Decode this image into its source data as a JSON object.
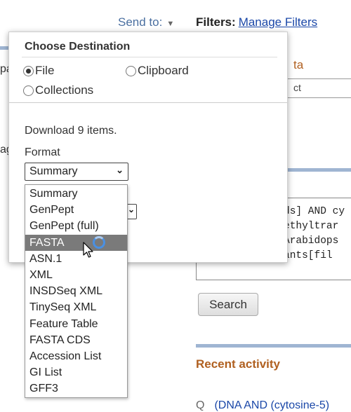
{
  "header": {
    "send_to": "Send to:",
    "filters_label": "Filters:",
    "manage_filters": "Manage Filters"
  },
  "background": {
    "left_cut_1": "pa",
    "left_cut_2": "ag",
    "right_heading_cut": "ta",
    "right_field_cut": "ct",
    "query_lines": [
      "ds] AND cy",
      "ethyltrar",
      "Arabidops",
      "ants[fil"
    ],
    "search_button": "Search",
    "recent_activity_title": "Recent activity",
    "recent_item": "(DNA AND (cytosine-5)"
  },
  "destination": {
    "title": "Choose Destination",
    "options": [
      {
        "label": "File",
        "selected": true
      },
      {
        "label": "Clipboard",
        "selected": false
      },
      {
        "label": "Collections",
        "selected": false
      }
    ],
    "download_text": "Download 9 items.",
    "format_label": "Format",
    "format_value": "Summary",
    "format_options": [
      "Summary",
      "GenPept",
      "GenPept (full)",
      "FASTA",
      "ASN.1",
      "XML",
      "INSDSeq XML",
      "TinySeq XML",
      "Feature Table",
      "FASTA CDS",
      "Accession List",
      "GI List",
      "GFF3"
    ],
    "highlighted_option": "FASTA"
  },
  "colors": {
    "link": "#1a47a8",
    "accent_heading": "#b06020",
    "section_rule": "#9fb5d2",
    "highlight": "#7a7a7a"
  }
}
